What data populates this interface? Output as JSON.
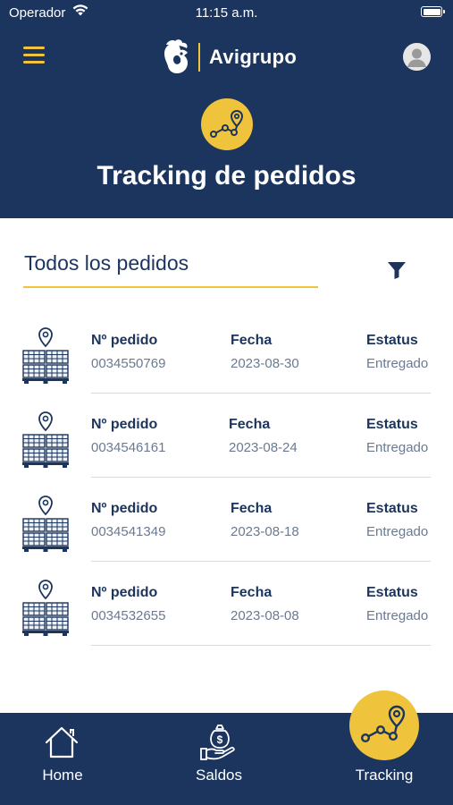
{
  "status_bar": {
    "carrier": "Operador",
    "time": "11:15 a.m."
  },
  "header": {
    "brand_name": "Avigrupo",
    "title": "Tracking de pedidos"
  },
  "section": {
    "title": "Todos los pedidos"
  },
  "columns": {
    "order": "Nº pedido",
    "date": "Fecha",
    "status": "Estatus"
  },
  "orders": [
    {
      "number": "0034550769",
      "date": "2023-08-30",
      "status": "Entregado"
    },
    {
      "number": "0034546161",
      "date": "2023-08-24",
      "status": "Entregado"
    },
    {
      "number": "0034541349",
      "date": "2023-08-18",
      "status": "Entregado"
    },
    {
      "number": "0034532655",
      "date": "2023-08-08",
      "status": "Entregado"
    }
  ],
  "bottom_nav": {
    "home": "Home",
    "saldos": "Saldos",
    "tracking": "Tracking",
    "active": "tracking"
  },
  "colors": {
    "primary": "#1c355e",
    "accent": "#f0c33c",
    "muted_text": "#6b7a90"
  },
  "icons": [
    "wifi-icon",
    "battery-icon",
    "menu-icon",
    "avigrupo-logo",
    "avatar-icon",
    "route-tracking-icon",
    "filter-icon",
    "location-pallet-icon",
    "home-icon",
    "money-hand-icon"
  ]
}
